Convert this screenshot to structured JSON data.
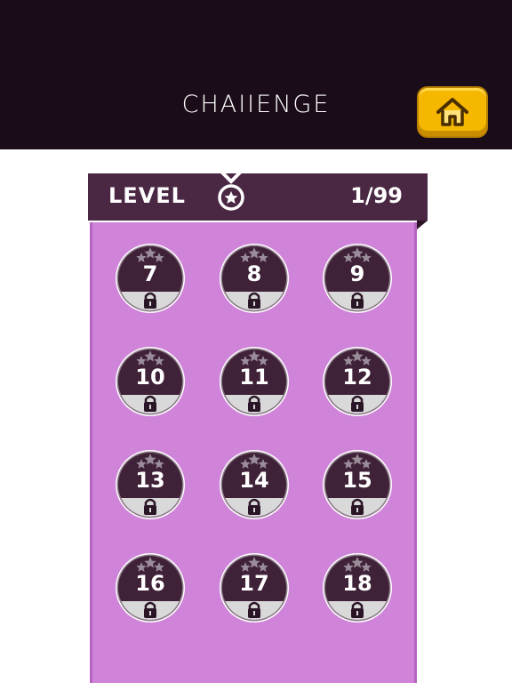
{
  "header": {
    "title": "CHAIIENGE",
    "home_icon": "home-icon"
  },
  "panel": {
    "level_label": "LEVEL",
    "level_count": "1/99",
    "medal_icon": "medal-icon"
  },
  "colors": {
    "topbar": "#1a0c18",
    "panel": "#cf84d9",
    "header_band": "#4a2743",
    "level_circle": "#3f2138",
    "lock_band": "#d9d9d9",
    "home_button": "#f5b700"
  },
  "levels": [
    {
      "number": "7",
      "stars": 0,
      "locked": true
    },
    {
      "number": "8",
      "stars": 0,
      "locked": true
    },
    {
      "number": "9",
      "stars": 0,
      "locked": true
    },
    {
      "number": "10",
      "stars": 0,
      "locked": true
    },
    {
      "number": "11",
      "stars": 0,
      "locked": true
    },
    {
      "number": "12",
      "stars": 0,
      "locked": true
    },
    {
      "number": "13",
      "stars": 0,
      "locked": true
    },
    {
      "number": "14",
      "stars": 0,
      "locked": true
    },
    {
      "number": "15",
      "stars": 0,
      "locked": true
    },
    {
      "number": "16",
      "stars": 0,
      "locked": true
    },
    {
      "number": "17",
      "stars": 0,
      "locked": true
    },
    {
      "number": "18",
      "stars": 0,
      "locked": true
    }
  ]
}
